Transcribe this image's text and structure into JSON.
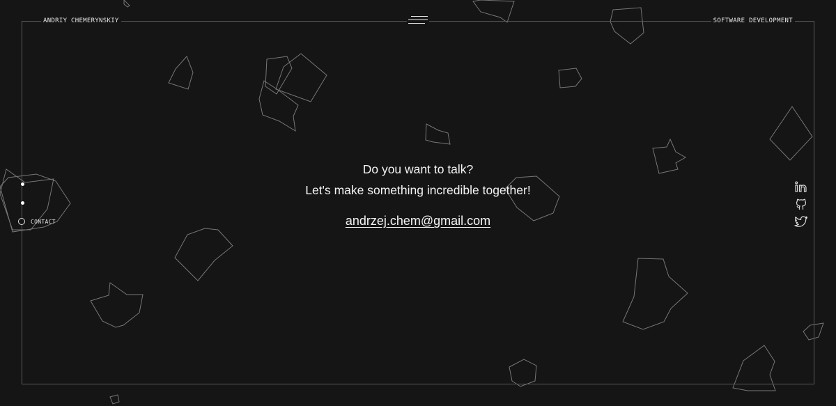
{
  "header": {
    "brand": "ANDRIY CHEMERYNSKIY",
    "tagline": "SOFTWARE DEVELOPMENT"
  },
  "side_nav": {
    "active_label": "CONTACT"
  },
  "contact": {
    "line1": "Do you want to talk?",
    "line2": "Let's make something incredible together!",
    "email": "andrzej.chem@gmail.com"
  },
  "socials": [
    "linkedin-icon",
    "github-icon",
    "twitter-icon"
  ],
  "colors": {
    "background": "#151515",
    "text": "#f4f4f4",
    "frame": "#5a5a5a",
    "shapes": "#7a7a7a"
  }
}
